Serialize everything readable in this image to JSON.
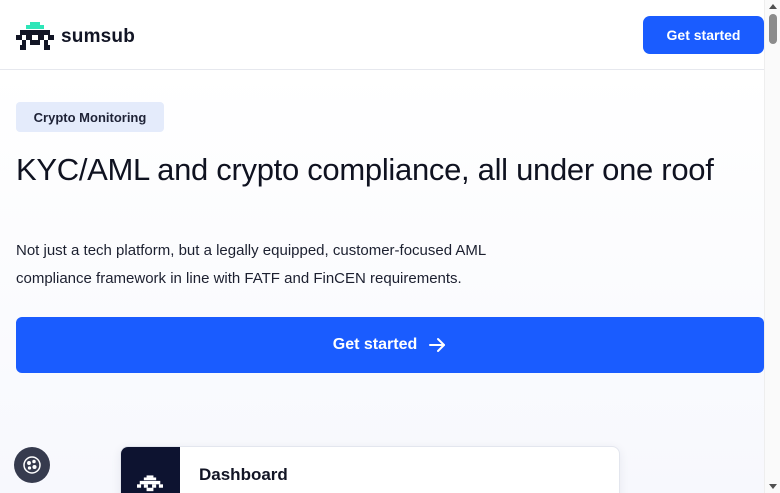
{
  "header": {
    "logo_text": "sumsub",
    "cta_label": "Get started"
  },
  "hero": {
    "badge": "Crypto Monitoring",
    "headline": "KYC/AML and crypto compliance, all under one roof",
    "subtext": "Not just a tech platform, but a legally equipped, customer-focused AML compliance framework in line with FATF and FinCEN requirements.",
    "cta_label": "Get started"
  },
  "dashboard_card": {
    "title": "Dashboard"
  },
  "colors": {
    "brand_blue": "#1a5cff",
    "logo_accent": "#2ee6b8",
    "dark_navy": "#0d1330",
    "badge_bg": "#e4ebfb"
  },
  "icons": {
    "logo": "sumsub-robot-icon",
    "arrow": "arrow-right-icon",
    "cookie": "cookie-icon"
  }
}
